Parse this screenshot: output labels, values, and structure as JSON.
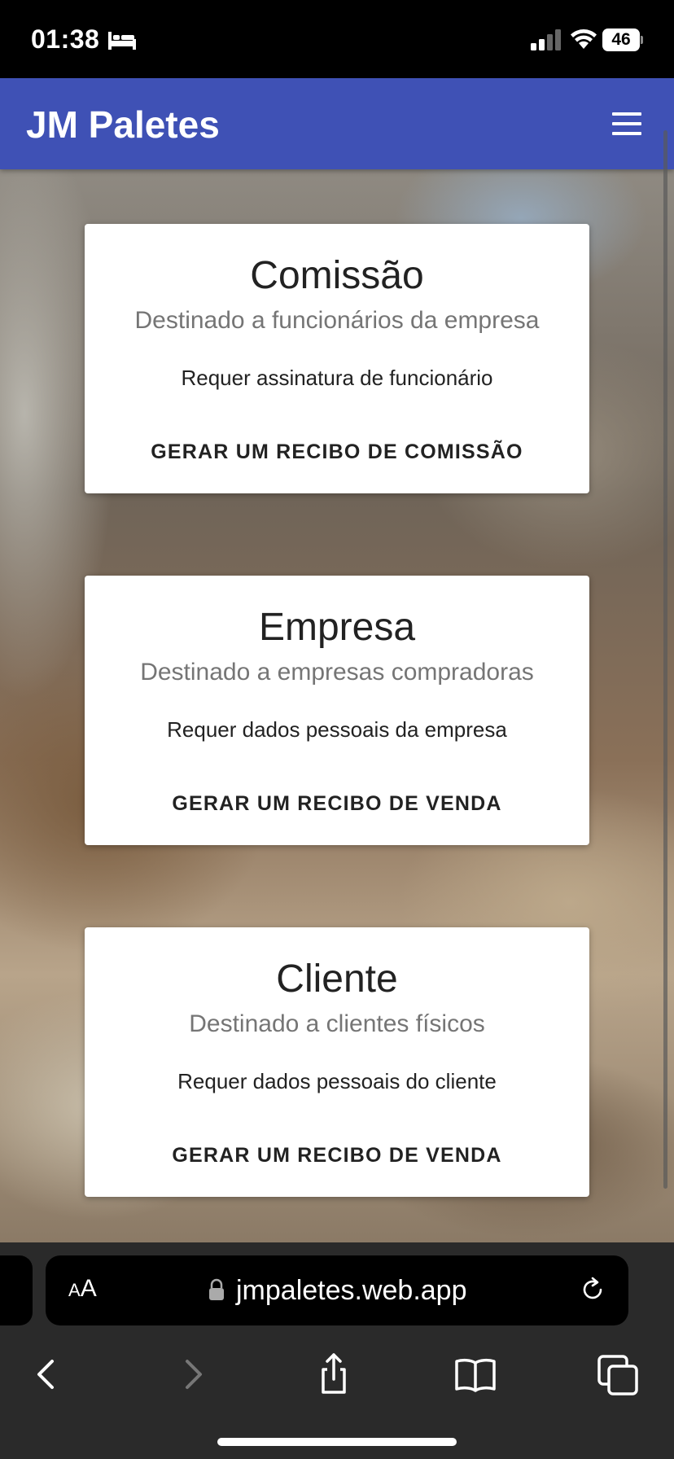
{
  "status_bar": {
    "time": "01:38",
    "battery": "46",
    "icons": [
      "bed-icon",
      "signal-icon",
      "wifi-icon",
      "battery-icon"
    ]
  },
  "header": {
    "title": "JM Paletes",
    "menu_icon": "hamburger-menu-icon",
    "color": "#3f51b5"
  },
  "cards": [
    {
      "title": "Comissão",
      "subtitle": "Destinado a funcionários da empresa",
      "text": "Requer assinatura de funcionário",
      "action": "GERAR UM RECIBO DE COMISSÃO"
    },
    {
      "title": "Empresa",
      "subtitle": "Destinado a empresas compradoras",
      "text": "Requer dados pessoais da empresa",
      "action": "GERAR UM RECIBO DE VENDA"
    },
    {
      "title": "Cliente",
      "subtitle": "Destinado a clientes físicos",
      "text": "Requer dados pessoais do cliente",
      "action": "GERAR UM RECIBO DE VENDA"
    }
  ],
  "browser": {
    "aa_label": "AA",
    "url": "jmpaletes.web.app",
    "icons": [
      "lock-icon",
      "reload-icon",
      "back-icon",
      "forward-icon",
      "share-icon",
      "bookmarks-icon",
      "tabs-icon"
    ]
  }
}
